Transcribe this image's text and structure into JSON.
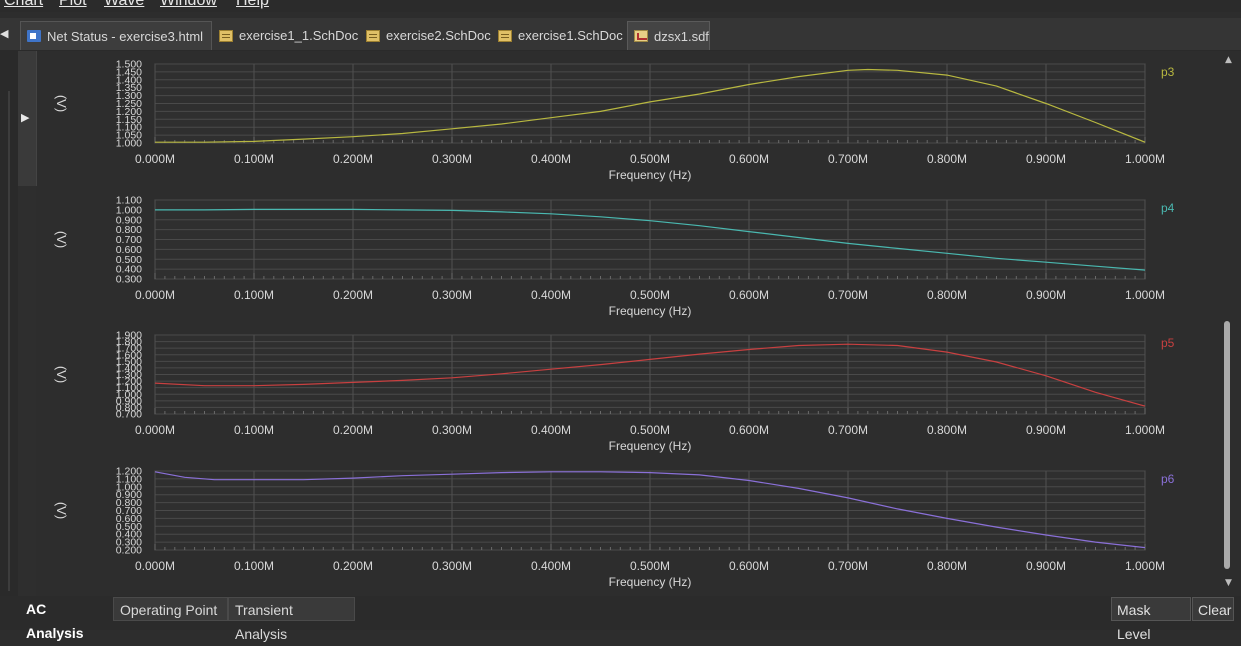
{
  "menu": [
    {
      "label": "Chart"
    },
    {
      "label": "Plot"
    },
    {
      "label": "Wave"
    },
    {
      "label": "Window"
    },
    {
      "label": "Help"
    }
  ],
  "tabs": [
    {
      "label": "Net Status - exercise3.html",
      "icon": "html-file-icon"
    },
    {
      "label": "exercise1_1.SchDoc",
      "icon": "schematic-file-icon"
    },
    {
      "label": "exercise2.SchDoc",
      "icon": "schematic-file-icon"
    },
    {
      "label": "exercise1.SchDoc",
      "icon": "schematic-file-icon"
    },
    {
      "label": "dzsx1.sdf",
      "icon": "simulation-file-icon"
    }
  ],
  "plot_y_unit_symbol": "(V)",
  "chart_data": [
    {
      "type": "line",
      "xlabel": "Frequency (Hz)",
      "xticks": [
        "0.000M",
        "0.100M",
        "0.200M",
        "0.300M",
        "0.400M",
        "0.500M",
        "0.600M",
        "0.700M",
        "0.800M",
        "0.900M",
        "1.000M"
      ],
      "xlim": [
        0,
        1.0
      ],
      "ylim": [
        1.0,
        1.5
      ],
      "yticks": [
        "1.500",
        "1.450",
        "1.400",
        "1.350",
        "1.300",
        "1.250",
        "1.200",
        "1.150",
        "1.100",
        "1.050",
        "1.000"
      ],
      "series": [
        {
          "name": "p3",
          "color": "#b8b840",
          "x": [
            0.0,
            0.05,
            0.1,
            0.15,
            0.2,
            0.25,
            0.3,
            0.35,
            0.4,
            0.45,
            0.5,
            0.55,
            0.6,
            0.65,
            0.7,
            0.72,
            0.75,
            0.8,
            0.85,
            0.9,
            0.95,
            1.0
          ],
          "y": [
            1.005,
            1.005,
            1.01,
            1.025,
            1.04,
            1.06,
            1.09,
            1.12,
            1.16,
            1.2,
            1.26,
            1.31,
            1.37,
            1.42,
            1.46,
            1.465,
            1.46,
            1.43,
            1.36,
            1.25,
            1.13,
            1.005
          ]
        }
      ]
    },
    {
      "type": "line",
      "xlabel": "Frequency (Hz)",
      "xticks": [
        "0.000M",
        "0.100M",
        "0.200M",
        "0.300M",
        "0.400M",
        "0.500M",
        "0.600M",
        "0.700M",
        "0.800M",
        "0.900M",
        "1.000M"
      ],
      "xlim": [
        0,
        1.0
      ],
      "ylim": [
        0.3,
        1.1
      ],
      "yticks": [
        "1.100",
        "1.000",
        "0.900",
        "0.800",
        "0.700",
        "0.600",
        "0.500",
        "0.400",
        "0.300"
      ],
      "series": [
        {
          "name": "p4",
          "color": "#4ab8b0",
          "x": [
            0.0,
            0.05,
            0.1,
            0.15,
            0.2,
            0.25,
            0.3,
            0.35,
            0.4,
            0.45,
            0.5,
            0.55,
            0.6,
            0.65,
            0.7,
            0.75,
            0.8,
            0.85,
            0.9,
            0.95,
            1.0
          ],
          "y": [
            1.0,
            1.0,
            1.005,
            1.005,
            1.005,
            1.0,
            0.995,
            0.98,
            0.96,
            0.93,
            0.89,
            0.84,
            0.78,
            0.72,
            0.66,
            0.61,
            0.56,
            0.51,
            0.47,
            0.43,
            0.39
          ]
        }
      ]
    },
    {
      "type": "line",
      "xlabel": "Frequency (Hz)",
      "xticks": [
        "0.000M",
        "0.100M",
        "0.200M",
        "0.300M",
        "0.400M",
        "0.500M",
        "0.600M",
        "0.700M",
        "0.800M",
        "0.900M",
        "1.000M"
      ],
      "xlim": [
        0,
        1.0
      ],
      "ylim": [
        0.7,
        1.9
      ],
      "yticks": [
        "1.900",
        "1.800",
        "1.700",
        "1.600",
        "1.500",
        "1.400",
        "1.300",
        "1.200",
        "1.100",
        "1.000",
        "0.900",
        "0.800",
        "0.700"
      ],
      "series": [
        {
          "name": "p5",
          "color": "#c84040",
          "x": [
            0.0,
            0.05,
            0.1,
            0.15,
            0.2,
            0.25,
            0.3,
            0.35,
            0.4,
            0.45,
            0.5,
            0.55,
            0.6,
            0.65,
            0.7,
            0.75,
            0.8,
            0.85,
            0.9,
            0.95,
            1.0
          ],
          "y": [
            1.17,
            1.13,
            1.13,
            1.15,
            1.18,
            1.21,
            1.25,
            1.31,
            1.38,
            1.45,
            1.53,
            1.61,
            1.68,
            1.74,
            1.76,
            1.74,
            1.64,
            1.49,
            1.28,
            1.03,
            0.82
          ]
        }
      ]
    },
    {
      "type": "line",
      "xlabel": "Frequency (Hz)",
      "xticks": [
        "0.000M",
        "0.100M",
        "0.200M",
        "0.300M",
        "0.400M",
        "0.500M",
        "0.600M",
        "0.700M",
        "0.800M",
        "0.900M",
        "1.000M"
      ],
      "xlim": [
        0,
        1.0
      ],
      "ylim": [
        0.2,
        1.2
      ],
      "yticks": [
        "1.200",
        "1.100",
        "1.000",
        "0.900",
        "0.800",
        "0.700",
        "0.600",
        "0.500",
        "0.400",
        "0.300",
        "0.200"
      ],
      "series": [
        {
          "name": "p6",
          "color": "#8a70d8",
          "x": [
            0.0,
            0.03,
            0.06,
            0.1,
            0.15,
            0.2,
            0.25,
            0.3,
            0.35,
            0.4,
            0.45,
            0.5,
            0.55,
            0.6,
            0.65,
            0.7,
            0.75,
            0.8,
            0.85,
            0.9,
            0.95,
            1.0
          ],
          "y": [
            1.19,
            1.12,
            1.09,
            1.09,
            1.09,
            1.11,
            1.14,
            1.16,
            1.18,
            1.19,
            1.19,
            1.18,
            1.15,
            1.08,
            0.98,
            0.86,
            0.72,
            0.6,
            0.49,
            0.39,
            0.3,
            0.23
          ]
        }
      ]
    }
  ],
  "bottom_tabs": [
    {
      "label": "AC Analysis"
    },
    {
      "label": "Operating Point"
    },
    {
      "label": "Transient Analysis"
    }
  ],
  "buttons": {
    "mask_level": "Mask Level",
    "clear": "Clear"
  }
}
